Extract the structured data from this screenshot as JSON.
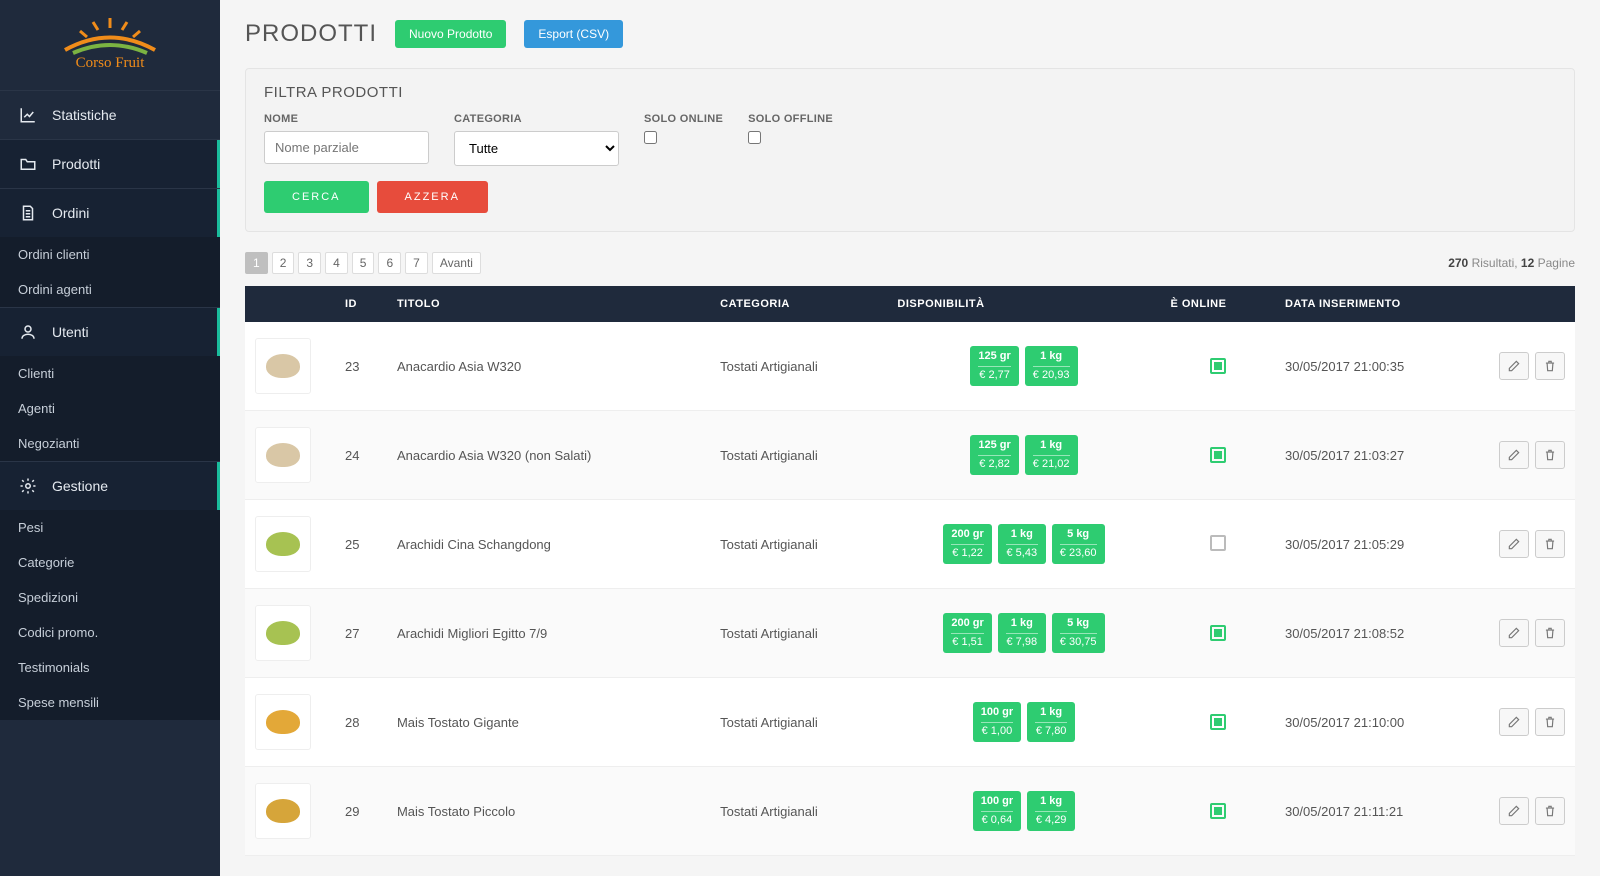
{
  "brand": {
    "name": "Corso Fruit"
  },
  "sidebar": {
    "items": [
      {
        "label": "Statistiche",
        "icon": "chart"
      },
      {
        "label": "Prodotti",
        "icon": "folder",
        "active": true
      },
      {
        "label": "Ordini",
        "icon": "doc",
        "parent": true,
        "sub": [
          "Ordini clienti",
          "Ordini agenti"
        ]
      },
      {
        "label": "Utenti",
        "icon": "user",
        "parent": true,
        "sub": [
          "Clienti",
          "Agenti",
          "Negozianti"
        ]
      },
      {
        "label": "Gestione",
        "icon": "gear",
        "parent": true,
        "sub": [
          "Pesi",
          "Categorie",
          "Spedizioni",
          "Codici promo.",
          "Testimonials",
          "Spese mensili"
        ]
      }
    ]
  },
  "page": {
    "title": "PRODOTTI",
    "new_button": "Nuovo Prodotto",
    "export_button": "Esport (CSV)"
  },
  "filter": {
    "title": "FILTRA PRODOTTI",
    "name_label": "NOME",
    "name_placeholder": "Nome parziale",
    "category_label": "CATEGORIA",
    "category_selected": "Tutte",
    "online_label": "SOLO ONLINE",
    "offline_label": "SOLO OFFLINE",
    "search": "CERCA",
    "reset": "AZZERA"
  },
  "pagination": {
    "pages": [
      "1",
      "2",
      "3",
      "4",
      "5",
      "6",
      "7"
    ],
    "next": "Avanti",
    "current": "1",
    "total_results": "270",
    "results_word": "Risultati,",
    "total_pages": "12",
    "pages_word": "Pagine"
  },
  "table": {
    "headers": {
      "id": "ID",
      "title": "TITOLO",
      "category": "CATEGORIA",
      "availability": "DISPONIBILITÀ",
      "online": "È ONLINE",
      "date": "DATA INSERIMENTO"
    },
    "rows": [
      {
        "id": "23",
        "title": "Anacardio Asia W320",
        "category": "Tostati Artigianali",
        "img_color": "#d9c7a6",
        "availability": [
          {
            "w": "125 gr",
            "p": "€ 2,77"
          },
          {
            "w": "1 kg",
            "p": "€ 20,93"
          }
        ],
        "online": true,
        "date": "30/05/2017 21:00:35"
      },
      {
        "id": "24",
        "title": "Anacardio Asia W320 (non Salati)",
        "category": "Tostati Artigianali",
        "img_color": "#d9c7a6",
        "availability": [
          {
            "w": "125 gr",
            "p": "€ 2,82"
          },
          {
            "w": "1 kg",
            "p": "€ 21,02"
          }
        ],
        "online": true,
        "date": "30/05/2017 21:03:27"
      },
      {
        "id": "25",
        "title": "Arachidi Cina Schangdong",
        "category": "Tostati Artigianali",
        "img_color": "#a7c252",
        "availability": [
          {
            "w": "200 gr",
            "p": "€ 1,22"
          },
          {
            "w": "1 kg",
            "p": "€ 5,43"
          },
          {
            "w": "5 kg",
            "p": "€ 23,60"
          }
        ],
        "online": false,
        "date": "30/05/2017 21:05:29"
      },
      {
        "id": "27",
        "title": "Arachidi Migliori Egitto 7/9",
        "category": "Tostati Artigianali",
        "img_color": "#a7c252",
        "availability": [
          {
            "w": "200 gr",
            "p": "€ 1,51"
          },
          {
            "w": "1 kg",
            "p": "€ 7,98"
          },
          {
            "w": "5 kg",
            "p": "€ 30,75"
          }
        ],
        "online": true,
        "date": "30/05/2017 21:08:52"
      },
      {
        "id": "28",
        "title": "Mais Tostato Gigante",
        "category": "Tostati Artigianali",
        "img_color": "#e3a838",
        "availability": [
          {
            "w": "100 gr",
            "p": "€ 1,00"
          },
          {
            "w": "1 kg",
            "p": "€ 7,80"
          }
        ],
        "online": true,
        "date": "30/05/2017 21:10:00"
      },
      {
        "id": "29",
        "title": "Mais Tostato Piccolo",
        "category": "Tostati Artigianali",
        "img_color": "#d6a53a",
        "availability": [
          {
            "w": "100 gr",
            "p": "€ 0,64"
          },
          {
            "w": "1 kg",
            "p": "€ 4,29"
          }
        ],
        "online": true,
        "date": "30/05/2017 21:11:21"
      }
    ]
  }
}
